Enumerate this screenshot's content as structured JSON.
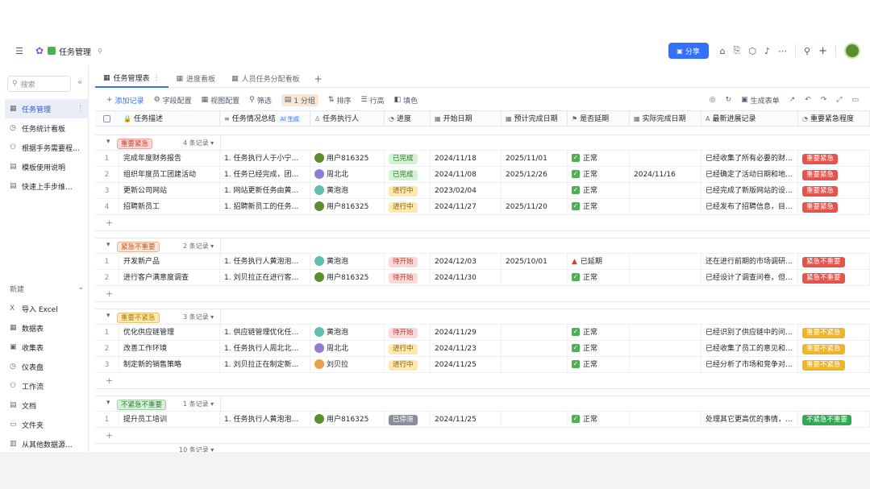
{
  "app": {
    "title": "任务管理",
    "share": "分享"
  },
  "sidebar": {
    "search_placeholder": "搜索",
    "items": [
      {
        "label": "任务管理",
        "active": true
      },
      {
        "label": "任务统计看板"
      },
      {
        "label": "根据手务需要程度..."
      },
      {
        "label": "模板使用说明"
      },
      {
        "label": "快速上手步维..."
      }
    ],
    "new_label": "新建",
    "new_items": [
      {
        "label": "导入 Excel",
        "icon": "excel-icon"
      },
      {
        "label": "数据表",
        "icon": "table-icon"
      },
      {
        "label": "收集表",
        "icon": "form-icon"
      },
      {
        "label": "仪表盘",
        "icon": "dashboard-icon"
      },
      {
        "label": "工作流",
        "icon": "workflow-icon"
      },
      {
        "label": "文档",
        "icon": "doc-icon"
      },
      {
        "label": "文件夹",
        "icon": "folder-icon"
      },
      {
        "label": "从其他数据源...",
        "icon": "datasource-icon"
      }
    ]
  },
  "tabs": [
    {
      "label": "任务管理表"
    },
    {
      "label": "进度看板"
    },
    {
      "label": "人员任务分配看板"
    }
  ],
  "toolbar": {
    "add": "添加记录",
    "fields": "字段配置",
    "view": "视图配置",
    "filter": "筛选",
    "group": "1 分组",
    "sort": "排序",
    "rowheight": "行高",
    "color": "填色",
    "gen_form": "生成表单"
  },
  "columns": [
    "任务描述",
    "任务情况总结",
    "任务执行人",
    "进度",
    "开始日期",
    "预计完成日期",
    "是否延期",
    "实际完成日期",
    "最新进展记录",
    "重要紧急程度"
  ],
  "ai_tag": "AI 生成",
  "groups": [
    {
      "label": "重要紧急",
      "count": "4 条记录",
      "color": "#f8d7d4",
      "text": "#d83931",
      "rows": [
        {
          "n": "1",
          "task": "完成年度财务报告",
          "summary": "1. 任务执行人于小宁正...",
          "person": "用户816325",
          "pcolor": "#5a8f2e",
          "prog": "已完成",
          "start": "2024/11/18",
          "due": "2025/11/01",
          "delay": "正常",
          "actual": "",
          "note": "已经收集了所有必要的财...",
          "pri": "重要紧急"
        },
        {
          "n": "2",
          "task": "组织年度员工团建活动",
          "summary": "1. 任务已经完成，团特...",
          "person": "周北北",
          "pcolor": "#8f7ad6",
          "prog": "已完成",
          "start": "2024/11/08",
          "due": "2025/12/26",
          "delay": "正常",
          "actual": "2024/11/16",
          "note": "已经确定了活动日期和地...",
          "pri": "重要紧急"
        },
        {
          "n": "3",
          "task": "更新公司网站",
          "summary": "1. 网站更新任务由黄泡...",
          "person": "黄泡泡",
          "pcolor": "#5fbfb0",
          "prog": "进行中",
          "start": "2023/02/04",
          "due": "",
          "delay": "正常",
          "actual": "",
          "note": "已经完成了新版网站的设...",
          "pri": "重要紧急"
        },
        {
          "n": "4",
          "task": "招聘新员工",
          "summary": "1. 招聘新员工的任务正...",
          "person": "用户816325",
          "pcolor": "#5a8f2e",
          "prog": "进行中",
          "start": "2024/11/27",
          "due": "2025/11/20",
          "delay": "正常",
          "actual": "",
          "note": "已经发布了招聘信息，目...",
          "pri": "重要紧急"
        }
      ]
    },
    {
      "label": "紧急不重要",
      "count": "2 条记录",
      "color": "#fbe3d6",
      "text": "#c25a1f",
      "rows": [
        {
          "n": "1",
          "task": "开发新产品",
          "summary": "1. 任务执行人黄泡泡已...",
          "person": "黄泡泡",
          "pcolor": "#5fbfb0",
          "prog": "待开始",
          "start": "2024/12/03",
          "due": "2025/10/01",
          "delay": "已延期",
          "actual": "",
          "note": "还在进行前期的市场调研...",
          "pri": "紧急不重要"
        },
        {
          "n": "2",
          "task": "进行客户满意度调查",
          "summary": "1. 刘贝拉正在进行客户...",
          "person": "用户816325",
          "pcolor": "#5a8f2e",
          "prog": "待开始",
          "start": "2024/11/30",
          "due": "",
          "delay": "正常",
          "actual": "",
          "note": "已经设计了调查问卷，但...",
          "pri": "紧急不重要"
        }
      ]
    },
    {
      "label": "重要不紧急",
      "count": "3 条记录",
      "color": "#fde8b0",
      "text": "#b07a00",
      "rows": [
        {
          "n": "1",
          "task": "优化供应链管理",
          "summary": "1. 供应链管理优化任务...",
          "person": "黄泡泡",
          "pcolor": "#5fbfb0",
          "prog": "待开始",
          "start": "2024/11/29",
          "due": "",
          "delay": "正常",
          "actual": "",
          "note": "已经识别了供应链中的问...",
          "pri": "重要不紧急"
        },
        {
          "n": "2",
          "task": "改善工作环境",
          "summary": "1. 任务执行人周北北正...",
          "person": "周北北",
          "pcolor": "#8f7ad6",
          "prog": "进行中",
          "start": "2024/11/23",
          "due": "",
          "delay": "正常",
          "actual": "",
          "note": "已经收集了员工的意见和...",
          "pri": "重要不紧急"
        },
        {
          "n": "3",
          "task": "制定新的销售策略",
          "summary": "1. 刘贝拉正在制定新的...",
          "person": "刘贝拉",
          "pcolor": "#e8a04a",
          "prog": "进行中",
          "start": "2024/11/25",
          "due": "",
          "delay": "正常",
          "actual": "",
          "note": "已经分析了市场和竞争对...",
          "pri": "重要不紧急"
        }
      ]
    },
    {
      "label": "不紧急不重要",
      "count": "1 条记录",
      "color": "#d6f0d6",
      "text": "#2f7d32",
      "rows": [
        {
          "n": "1",
          "task": "提升员工培训",
          "summary": "1. 任务执行人黄泡泡正...",
          "person": "用户816325",
          "pcolor": "#5a8f2e",
          "prog": "已停滞",
          "start": "2024/11/25",
          "due": "",
          "delay": "正常",
          "actual": "",
          "note": "处理其它更高优的事情，...",
          "pri": "不紧急不重要"
        }
      ]
    }
  ],
  "total": "10 条记录",
  "status_colors": {
    "已完成": [
      "#d4f2d4",
      "#2f7d32"
    ],
    "进行中": [
      "#fde8b0",
      "#8a6100"
    ],
    "待开始": [
      "#fbd9d9",
      "#c43d3d"
    ],
    "已停滞": [
      "#8a8f99",
      "#ffffff"
    ]
  },
  "pri_colors": {
    "重要紧急": [
      "#e5534b",
      "#fff"
    ],
    "紧急不重要": [
      "#e5534b",
      "#fff"
    ],
    "重要不紧急": [
      "#f0b429",
      "#fff"
    ],
    "不紧急不重要": [
      "#34a853",
      "#fff"
    ]
  }
}
